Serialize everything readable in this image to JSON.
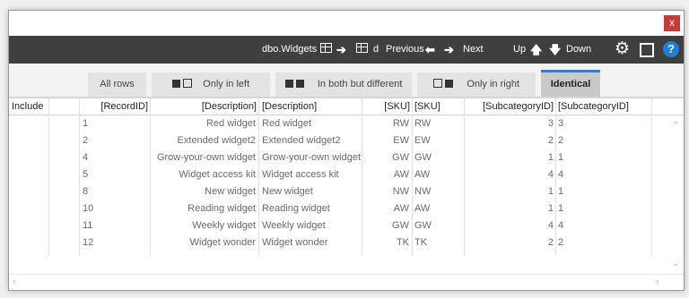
{
  "window": {
    "close_label": "x"
  },
  "toolbar": {
    "table_name": "dbo.Widgets",
    "d_label": "d",
    "previous_label": "Previous",
    "next_label": "Next",
    "up_label": "Up",
    "down_label": "Down",
    "icons": [
      "grid-icon",
      "arrow-right-icon",
      "grid-icon",
      "arrow-left-icon",
      "arrow-right-icon",
      "arrow-up-icon",
      "arrow-down-icon",
      "gear-icon",
      "export-icon",
      "help-icon"
    ],
    "help_glyph": "?",
    "background": "#3f3f3f"
  },
  "tabs": [
    {
      "label": "All rows"
    },
    {
      "label": "Only in left"
    },
    {
      "label": "In both but different"
    },
    {
      "label": "Only in right"
    },
    {
      "label": "Identical",
      "active": true
    }
  ],
  "accent_color": "#2f7fd3",
  "grid": {
    "headers": [
      "Include",
      "[RecordID]",
      "[Description]",
      "[Description]",
      "[SKU]",
      "[SKU]",
      "[SubcategoryID]",
      "[SubcategoryID]"
    ],
    "rows": [
      {
        "id": "1",
        "desc_l": "Red widget",
        "desc_r": "Red widget",
        "sku_l": "RW",
        "sku_r": "RW",
        "sub_l": "3",
        "sub_r": "3"
      },
      {
        "id": "2",
        "desc_l": "Extended widget2",
        "desc_r": "Extended widget2",
        "sku_l": "EW",
        "sku_r": "EW",
        "sub_l": "2",
        "sub_r": "2"
      },
      {
        "id": "4",
        "desc_l": "Grow-your-own widget",
        "desc_r": "Grow-your-own widget",
        "sku_l": "GW",
        "sku_r": "GW",
        "sub_l": "1",
        "sub_r": "1"
      },
      {
        "id": "5",
        "desc_l": "Widget access kit",
        "desc_r": "Widget access kit",
        "sku_l": "AW",
        "sku_r": "AW",
        "sub_l": "4",
        "sub_r": "4"
      },
      {
        "id": "8",
        "desc_l": "New widget",
        "desc_r": "New widget",
        "sku_l": "NW",
        "sku_r": "NW",
        "sub_l": "1",
        "sub_r": "1"
      },
      {
        "id": "10",
        "desc_l": "Reading widget",
        "desc_r": "Reading widget",
        "sku_l": "AW",
        "sku_r": "AW",
        "sub_l": "1",
        "sub_r": "1"
      },
      {
        "id": "11",
        "desc_l": "Weekly widget",
        "desc_r": "Weekly widget",
        "sku_l": "GW",
        "sku_r": "GW",
        "sub_l": "4",
        "sub_r": "4"
      },
      {
        "id": "12",
        "desc_l": "Widget wonder",
        "desc_r": "Widget wonder",
        "sku_l": "TK",
        "sku_r": "TK",
        "sub_l": "2",
        "sub_r": "2"
      }
    ]
  }
}
